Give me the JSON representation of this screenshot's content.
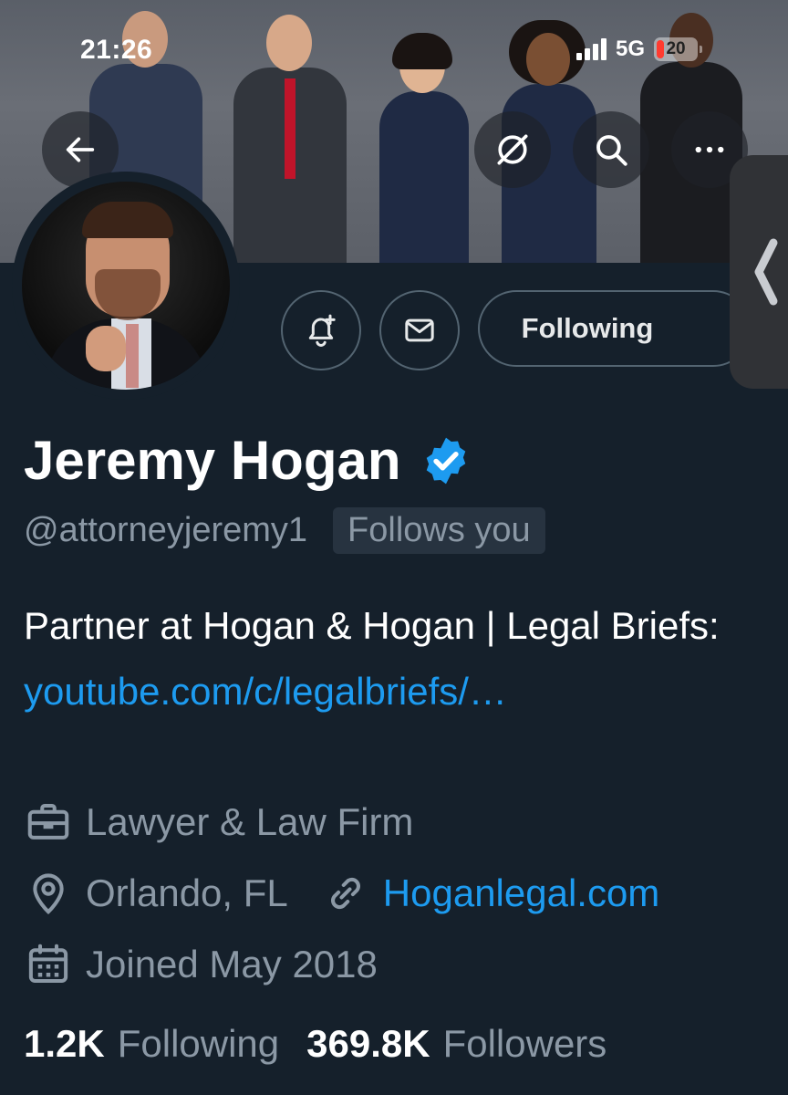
{
  "status_bar": {
    "time": "21:26",
    "network": "5G",
    "battery": "20"
  },
  "profile": {
    "name": "Jeremy Hogan",
    "handle": "@attorneyjeremy1",
    "follows_you": "Follows you",
    "bio_text": "Partner at Hogan & Hogan | Legal Briefs: ",
    "bio_link": "youtube.com/c/legalbriefs/…",
    "category": "Lawyer & Law Firm",
    "location": "Orlando, FL",
    "website": "Hoganlegal.com",
    "joined": "Joined May 2018",
    "following_count": "1.2K",
    "following_label": "Following",
    "followers_count": "369.8K",
    "followers_label": "Followers"
  },
  "actions": {
    "following_button": "Following"
  },
  "icons": {
    "back": "back-arrow-icon",
    "grok": "grok-icon",
    "search": "search-icon",
    "more": "more-icon",
    "notify": "bell-plus-icon",
    "message": "envelope-icon",
    "verified": "verified-badge-icon",
    "category": "briefcase-icon",
    "location": "location-pin-icon",
    "website": "link-icon",
    "joined": "calendar-icon",
    "side_tab": "chevron-left-icon"
  },
  "colors": {
    "background": "#15202b",
    "accent": "#1d9bf0",
    "secondary_text": "#8b98a5",
    "battery_low": "#ff3b30"
  }
}
